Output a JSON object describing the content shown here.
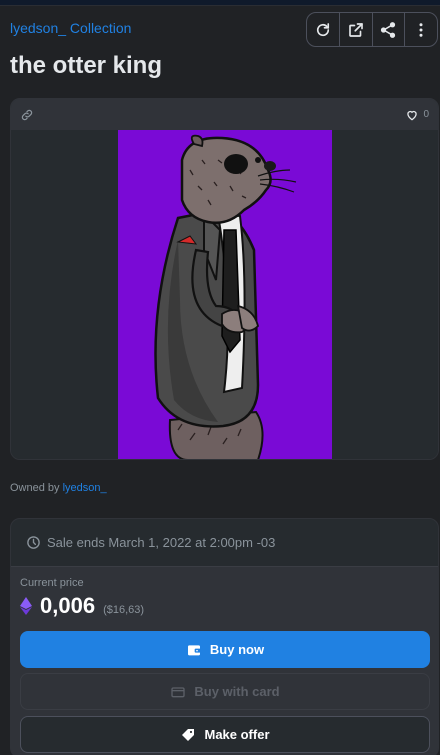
{
  "collection": {
    "label": "lyedson_ Collection"
  },
  "actions": [
    {
      "icon": "refresh-icon"
    },
    {
      "icon": "external-link-icon"
    },
    {
      "icon": "share-icon"
    },
    {
      "icon": "more-icon"
    }
  ],
  "item": {
    "title": "the otter king"
  },
  "media": {
    "favorites": "0",
    "art_bg": "#7a0ad6"
  },
  "owner": {
    "prefix": "Owned by",
    "name": "lyedson_"
  },
  "sale": {
    "ends_text": "Sale ends March 1, 2022 at 2:00pm -03"
  },
  "price": {
    "label": "Current price",
    "value": "0,006",
    "usd": "($16,63)",
    "currency_icon": "ethereum-icon"
  },
  "buttons": {
    "buy_now": "Buy now",
    "buy_with_card": "Buy with card",
    "make_offer": "Make offer"
  },
  "colors": {
    "accent": "#2081e2",
    "background": "#202225",
    "card": "#303339"
  }
}
